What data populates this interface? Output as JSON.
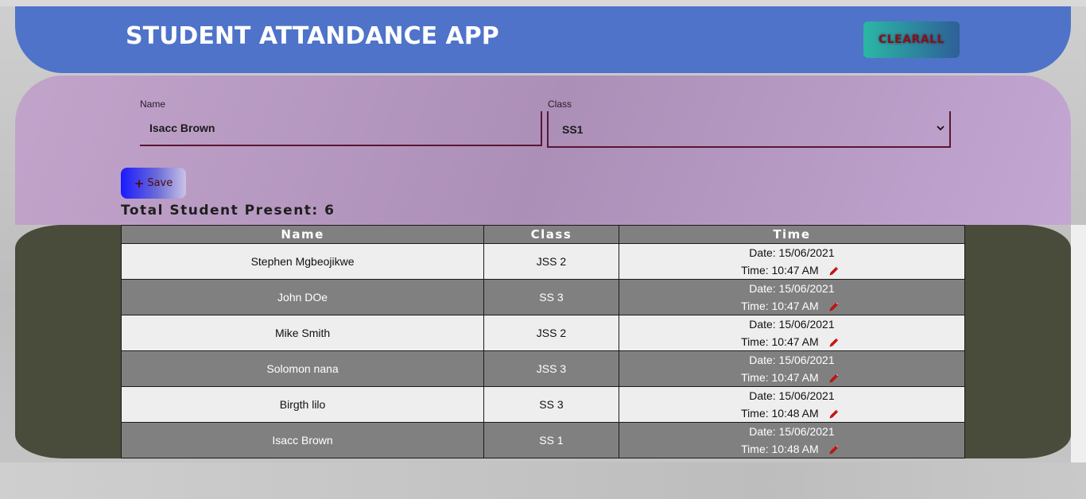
{
  "header": {
    "title": "STUDENT ATTANDANCE APP",
    "clear_label": "CLEARALL"
  },
  "form": {
    "name_label": "Name",
    "name_value": "Isacc Brown",
    "class_label": "Class",
    "class_value": "SS1",
    "save_label": "Save",
    "save_icon": "plus-icon"
  },
  "summary": {
    "total_present_text": "Total Student Present: 6"
  },
  "table": {
    "headers": [
      "Name",
      "Class",
      "Time"
    ],
    "rows": [
      {
        "name": "Stephen Mgbeojikwe",
        "class": "JSS 2",
        "date": "Date: 15/06/2021",
        "time": "Time: 10:47 AM"
      },
      {
        "name": "John DOe",
        "class": "SS 3",
        "date": "Date: 15/06/2021",
        "time": "Time: 10:47 AM"
      },
      {
        "name": "Mike Smith",
        "class": "JSS 2",
        "date": "Date: 15/06/2021",
        "time": "Time: 10:47 AM"
      },
      {
        "name": "Solomon nana",
        "class": "JSS 3",
        "date": "Date: 15/06/2021",
        "time": "Time: 10:47 AM"
      },
      {
        "name": "Birgth lilo",
        "class": "SS 3",
        "date": "Date: 15/06/2021",
        "time": "Time: 10:48 AM"
      },
      {
        "name": "Isacc Brown",
        "class": "SS 1",
        "date": "Date: 15/06/2021",
        "time": "Time: 10:48 AM"
      }
    ],
    "edit_icon": "pencil-icon"
  },
  "colors": {
    "header_bg": "#4e73c9",
    "form_bg": "#b598c0",
    "table_bg": "#4a4c3b",
    "row_light": "#eeeeee",
    "row_dark": "#808080",
    "edit_icon": "#e01010"
  }
}
